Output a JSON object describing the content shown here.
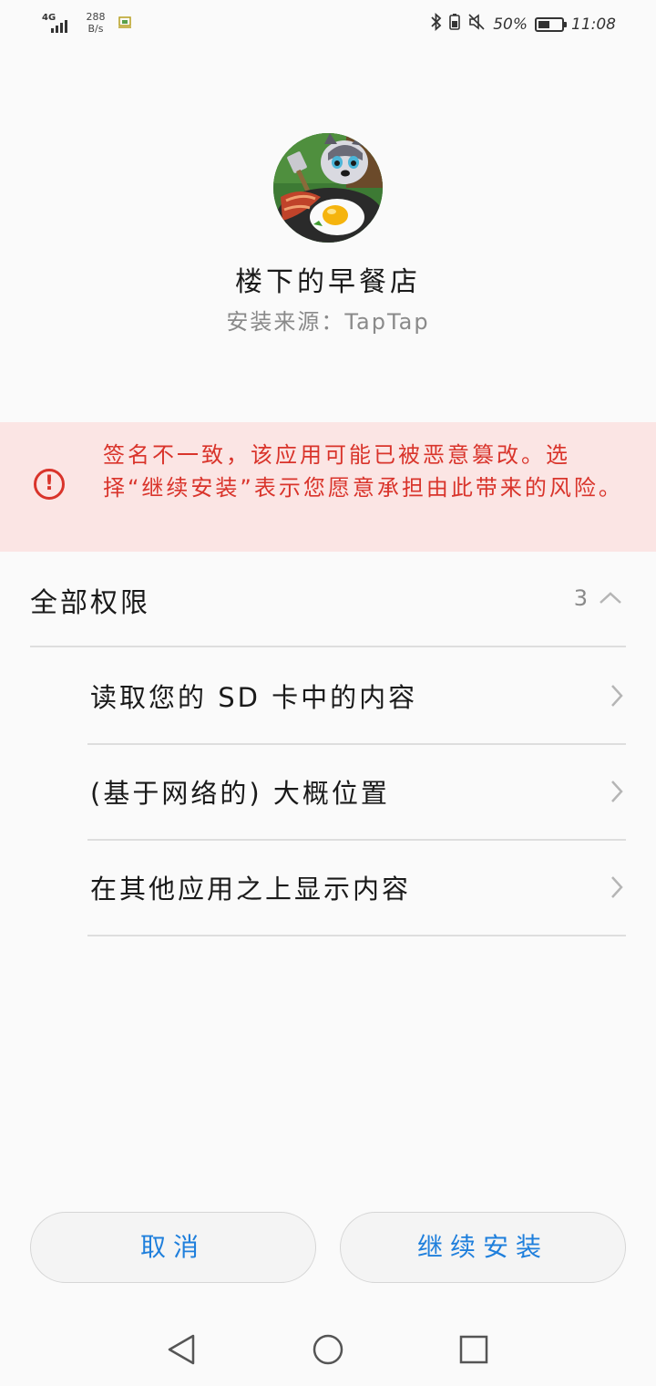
{
  "status_bar": {
    "network": "4G",
    "speed_value": "288",
    "speed_unit": "B/s",
    "battery_percent": "50%",
    "battery_level": 0.5,
    "time": "11:08"
  },
  "app": {
    "name": "楼下的早餐店",
    "source": "安装来源：TapTap"
  },
  "warning": {
    "text": "签名不一致，该应用可能已被恶意篡改。选择“继续安装”表示您愿意承担由此带来的风险。",
    "color": "#d9342b",
    "background": "#fbe5e4"
  },
  "permissions": {
    "title": "全部权限",
    "count": "3",
    "items": [
      {
        "label": "读取您的 SD 卡中的内容"
      },
      {
        "label": "(基于网络的) 大概位置"
      },
      {
        "label": "在其他应用之上显示内容"
      }
    ]
  },
  "buttons": {
    "cancel": "取消",
    "continue": "继续安装",
    "accent": "#1f7fdc"
  },
  "icons": {
    "nav": [
      "back-icon",
      "home-icon",
      "recent-apps-icon"
    ]
  }
}
